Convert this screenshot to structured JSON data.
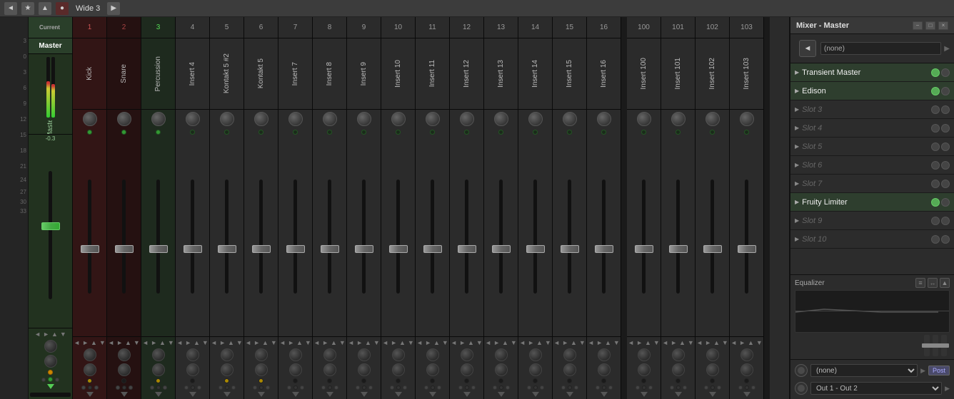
{
  "toolbar": {
    "title": "Wide 3",
    "icons": [
      "arrow-left",
      "star",
      "arrow-up",
      "record",
      "arrow-right"
    ]
  },
  "right_panel": {
    "title": "Mixer - Master",
    "win_btns": [
      "-",
      "□",
      "×"
    ],
    "routing_btn": "◄",
    "preset": "(none)",
    "slots": [
      {
        "name": "Transient Master",
        "active": true,
        "dimmed": false
      },
      {
        "name": "Edison",
        "active": true,
        "dimmed": false
      },
      {
        "name": "Slot 3",
        "active": false,
        "dimmed": true
      },
      {
        "name": "Slot 4",
        "active": false,
        "dimmed": true
      },
      {
        "name": "Slot 5",
        "active": false,
        "dimmed": true
      },
      {
        "name": "Slot 6",
        "active": false,
        "dimmed": true
      },
      {
        "name": "Slot 7",
        "active": false,
        "dimmed": true
      },
      {
        "name": "Fruity Limiter",
        "active": true,
        "dimmed": false
      },
      {
        "name": "Slot 9",
        "active": false,
        "dimmed": true
      },
      {
        "name": "Slot 10",
        "active": false,
        "dimmed": true
      }
    ],
    "equalizer_label": "Equalizer",
    "bottom_route_1": "(none)",
    "post_label": "Post",
    "bottom_route_2": "Out 1 - Out 2"
  },
  "mixer": {
    "current_label": "Current",
    "master_label": "Master",
    "channels": [
      {
        "num": "1",
        "name": "Kick",
        "color": "red",
        "value": "",
        "led": true
      },
      {
        "num": "2",
        "name": "Snare",
        "color": "dark-red",
        "value": "",
        "led": true
      },
      {
        "num": "3",
        "name": "Percussion",
        "color": "green",
        "value": "",
        "led": true
      },
      {
        "num": "4",
        "name": "Insert 4",
        "color": "normal",
        "value": "",
        "led": false
      },
      {
        "num": "5",
        "name": "Kontakt 5 #2",
        "color": "normal",
        "value": "",
        "led": false
      },
      {
        "num": "6",
        "name": "Kontakt 5",
        "color": "normal",
        "value": "",
        "led": false
      },
      {
        "num": "7",
        "name": "Insert 7",
        "color": "normal",
        "value": "",
        "led": false
      },
      {
        "num": "8",
        "name": "Insert 8",
        "color": "normal",
        "value": "",
        "led": false
      },
      {
        "num": "9",
        "name": "Insert 9",
        "color": "normal",
        "value": "",
        "led": false
      },
      {
        "num": "10",
        "name": "Insert 10",
        "color": "normal",
        "value": "",
        "led": false
      },
      {
        "num": "11",
        "name": "Insert 11",
        "color": "normal",
        "value": "",
        "led": false
      },
      {
        "num": "12",
        "name": "Insert 12",
        "color": "normal",
        "value": "",
        "led": false
      },
      {
        "num": "13",
        "name": "Insert 13",
        "color": "normal",
        "value": "",
        "led": false
      },
      {
        "num": "14",
        "name": "Insert 14",
        "color": "normal",
        "value": "",
        "led": false
      },
      {
        "num": "15",
        "name": "Insert 15",
        "color": "normal",
        "value": "",
        "led": false
      },
      {
        "num": "16",
        "name": "Insert 16",
        "color": "normal",
        "value": "",
        "led": false
      },
      {
        "num": "100",
        "name": "Insert 100",
        "color": "normal",
        "value": "",
        "led": false
      },
      {
        "num": "101",
        "name": "Insert 101",
        "color": "normal",
        "value": "",
        "led": false
      },
      {
        "num": "102",
        "name": "Insert 102",
        "color": "normal",
        "value": "",
        "led": false
      },
      {
        "num": "103",
        "name": "Insert 103",
        "color": "normal",
        "value": "",
        "led": false
      }
    ],
    "db_marks": [
      "3",
      "0",
      "3",
      "6",
      "9",
      "12",
      "15",
      "18",
      "21",
      "24",
      "27",
      "30",
      "33"
    ],
    "master_value": "-0.3"
  }
}
